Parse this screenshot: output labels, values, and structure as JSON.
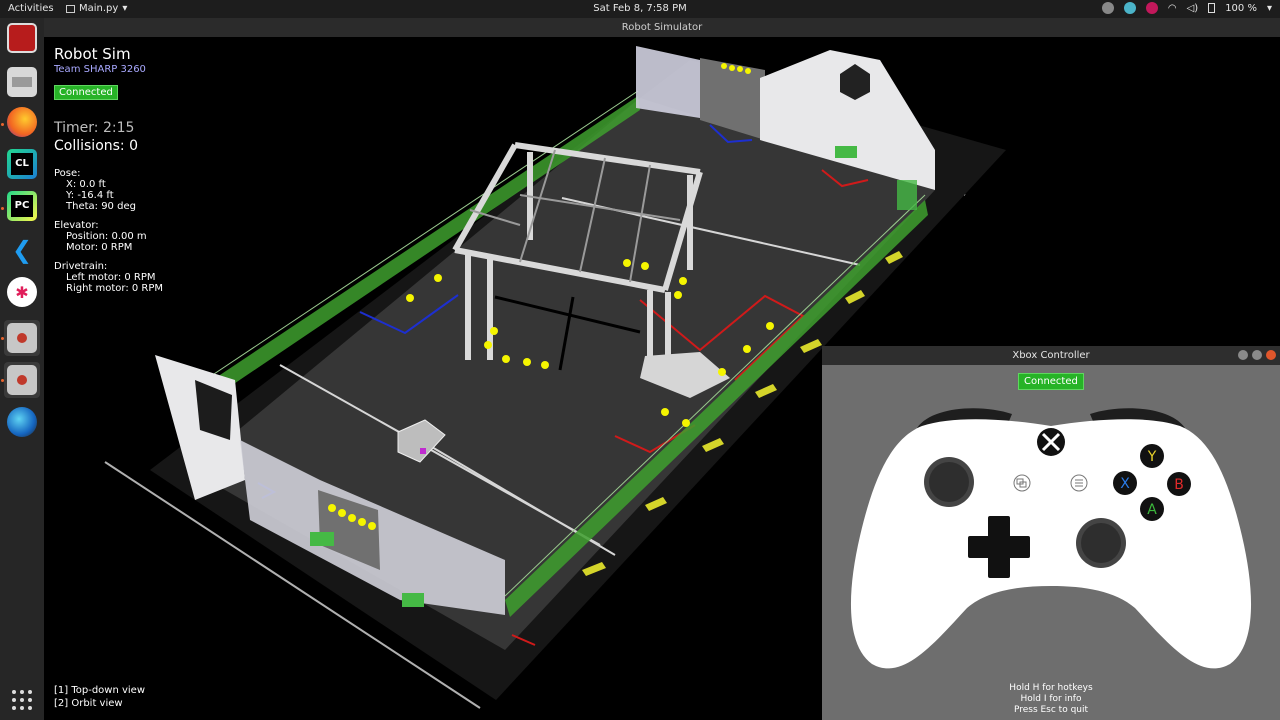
{
  "topbar": {
    "activities": "Activities",
    "app_menu": "Main.py",
    "clock": "Sat Feb  8,  7:58 PM",
    "battery": "100 %"
  },
  "window": {
    "title": "Robot Simulator"
  },
  "dock": {
    "icons": [
      "terminal-icon",
      "files-icon",
      "firefox-icon",
      "clion-icon",
      "pycharm-icon",
      "vscode-icon",
      "slack-icon",
      "robot-sim-icon",
      "robot-sim-icon",
      "globe-icon",
      "app-grid-icon"
    ]
  },
  "hud": {
    "title": "Robot Sim",
    "team": "Team SHARP 3260",
    "status": "Connected",
    "timer": "Timer: 2:15",
    "collisions": "Collisions: 0",
    "pose_title": "Pose:",
    "pose_x": "X: 0.0 ft",
    "pose_y": "Y: -16.4 ft",
    "pose_theta": "Theta: 90 deg",
    "elevator_title": "Elevator:",
    "elevator_position": "Position: 0.00 m",
    "elevator_motor": "Motor: 0 RPM",
    "drivetrain_title": "Drivetrain:",
    "left_motor": "Left motor: 0 RPM",
    "right_motor": "Right motor: 0 RPM"
  },
  "views": {
    "top_down": "[1] Top-down view",
    "orbit": "[2] Orbit view"
  },
  "controller": {
    "title": "Xbox Controller",
    "status": "Connected",
    "buttons": {
      "y": "Y",
      "x": "X",
      "b": "B",
      "a": "A"
    },
    "hint_hotkeys": "Hold H for hotkeys",
    "hint_info": "Hold I for info",
    "hint_quit": "Press Esc to quit"
  }
}
